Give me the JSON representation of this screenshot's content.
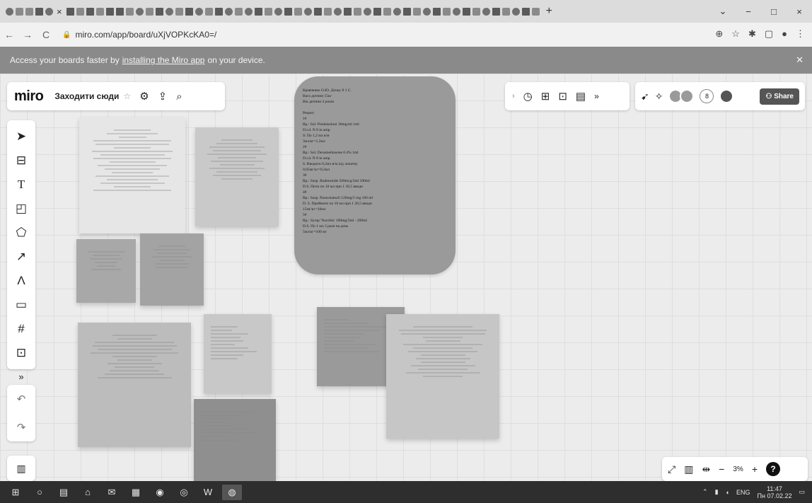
{
  "browser": {
    "tab_close": "×",
    "new_tab": "+",
    "url": "miro.com/app/board/uXjVOPKcKA0=/",
    "window_controls": [
      "⌄",
      "−",
      "□",
      "×"
    ]
  },
  "banner": {
    "prefix": "Access your boards faster by",
    "link": "installing the Miro app",
    "suffix": "on your device."
  },
  "board": {
    "logo": "miro",
    "name": "Заходити сюди",
    "share_label": "Share",
    "collab_count": "8",
    "zoom_level": "3%"
  },
  "rx_card": {
    "text": "Кравченко О.Ю. Дочку 8 1 С.\nВага дитини 15кг\nВік дитини 4 років\n\nРецепт\n1#\nRp.: Sol. Prednisoloni 30mg/ml 1ml\nD.t.d. N 8 in amp.\nS: По 1,2 мл в/м\n3мл/кг=1,2мл\n2#\nRp.: Sol. Dexamethasone 0.4% 1ml\nD.t.d. N 8 in amp.\nS. Вводити 0,2мл в/м під лопатку\n0,05мг/кг=0,2мл\n3#\nRp.: Susp. Budesonide 500mcg/2ml 100ml\nD.S. Пити по 10 мл при 1 30,5 вводи\n4#\nRp.: Susp. Paracetamoli 120mg/5 mg 100 ml\nD. S. Приймати по 10 мл при 1 30,5 вводи\n15мг/кг=10мл\n5#\nRp.: Syrup 'Nurofen' 100mg/5ml - 200ml\nD.S. По 1 мл 3 рази на день\n5мл/кг=100 мг"
  },
  "taskbar": {
    "language": "ENG",
    "time": "11:47",
    "date": "Пн 07.02.22"
  }
}
